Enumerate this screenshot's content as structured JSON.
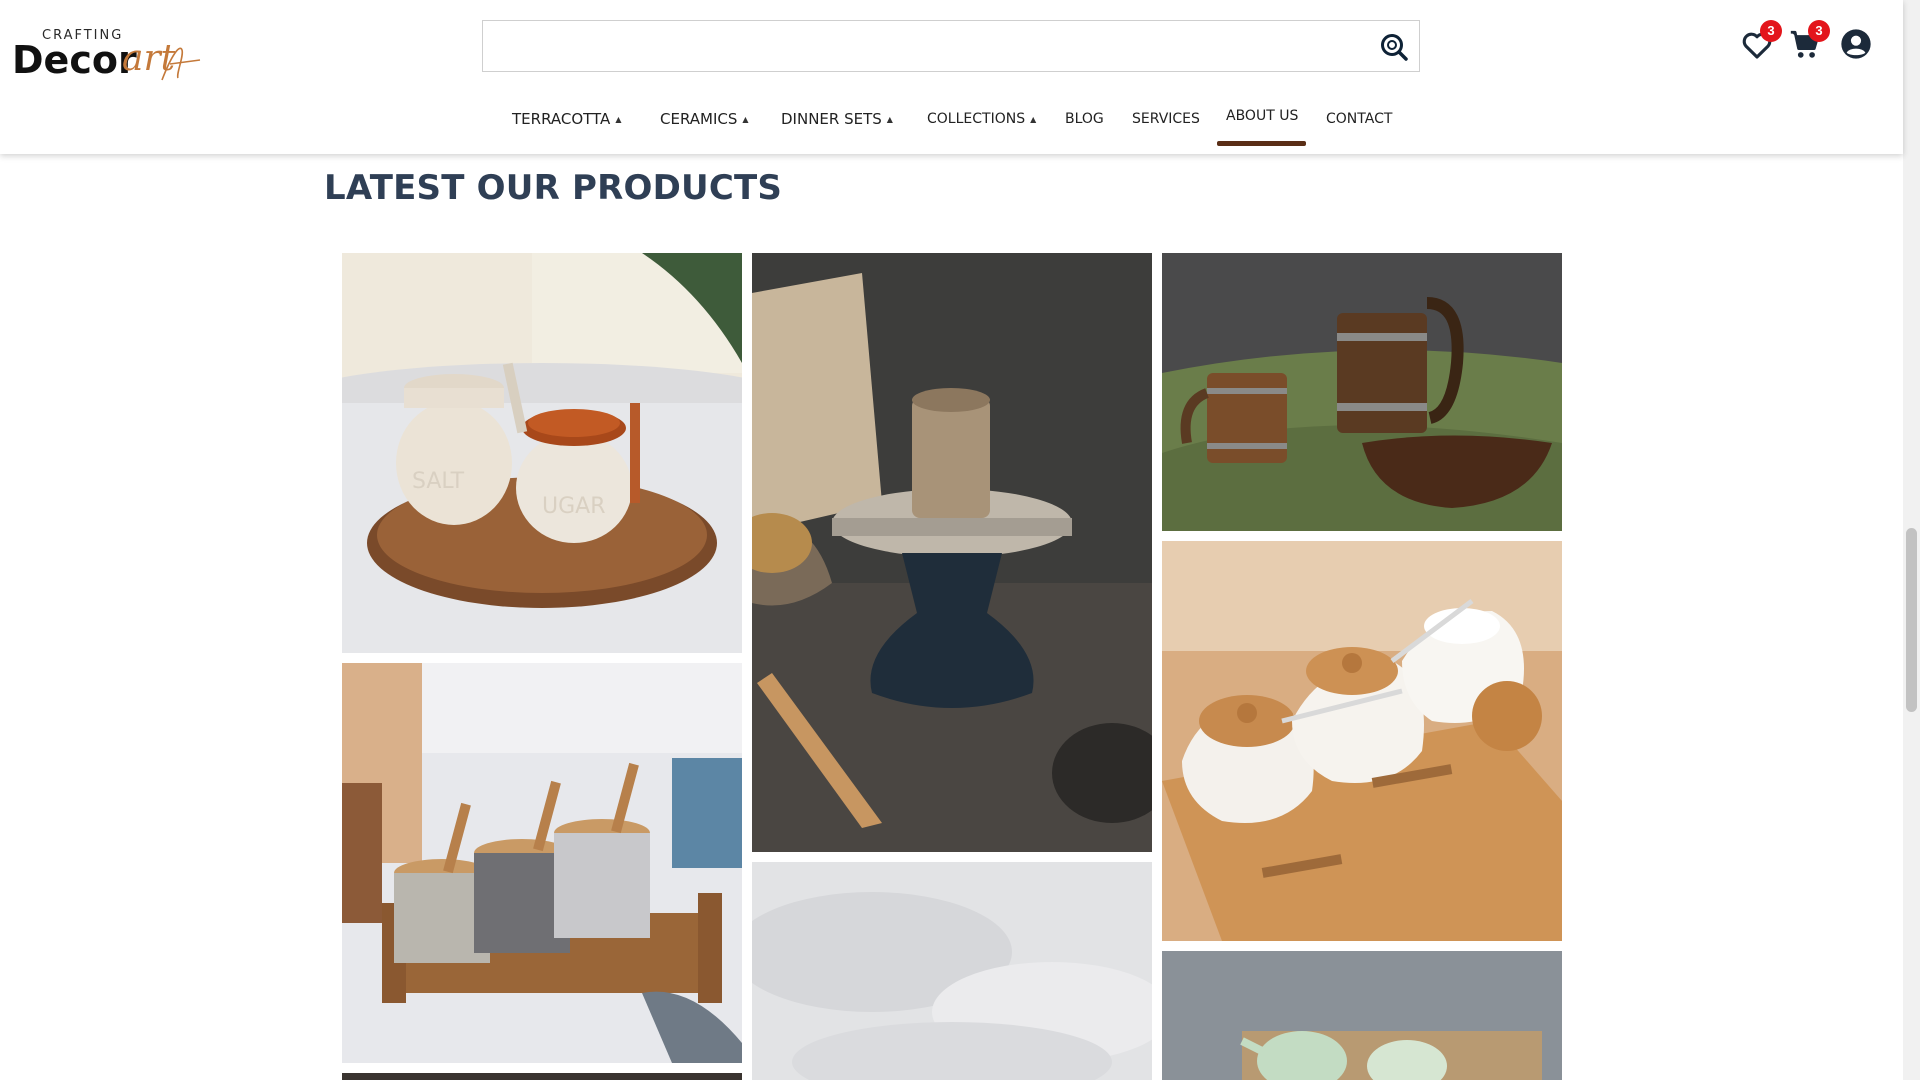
{
  "brand": {
    "top_word": "CRAFTING",
    "main_word": "Decor",
    "script_word": "art"
  },
  "search": {
    "value": "",
    "placeholder": ""
  },
  "header_icons": {
    "wishlist_count": "3",
    "cart_count": "3"
  },
  "nav": {
    "items": [
      {
        "label": "TERRACOTTA",
        "has_dropdown": true
      },
      {
        "label": "CERAMICS",
        "has_dropdown": true
      },
      {
        "label": "DINNER SETS",
        "has_dropdown": true
      },
      {
        "label": "COLLECTIONS",
        "has_dropdown": true
      },
      {
        "label": "BLOG",
        "has_dropdown": false
      },
      {
        "label": "SERVICES",
        "has_dropdown": false
      },
      {
        "label": "ABOUT US",
        "has_dropdown": false
      },
      {
        "label": "CONTACT",
        "has_dropdown": false
      }
    ],
    "active": "ABOUT US",
    "caret_glyph": "▲"
  },
  "section": {
    "title": "LATEST OUR PRODUCTS"
  },
  "colors": {
    "accent_bar": "#5a2e16",
    "badge": "#e3151b",
    "title": "#2f3f55"
  }
}
